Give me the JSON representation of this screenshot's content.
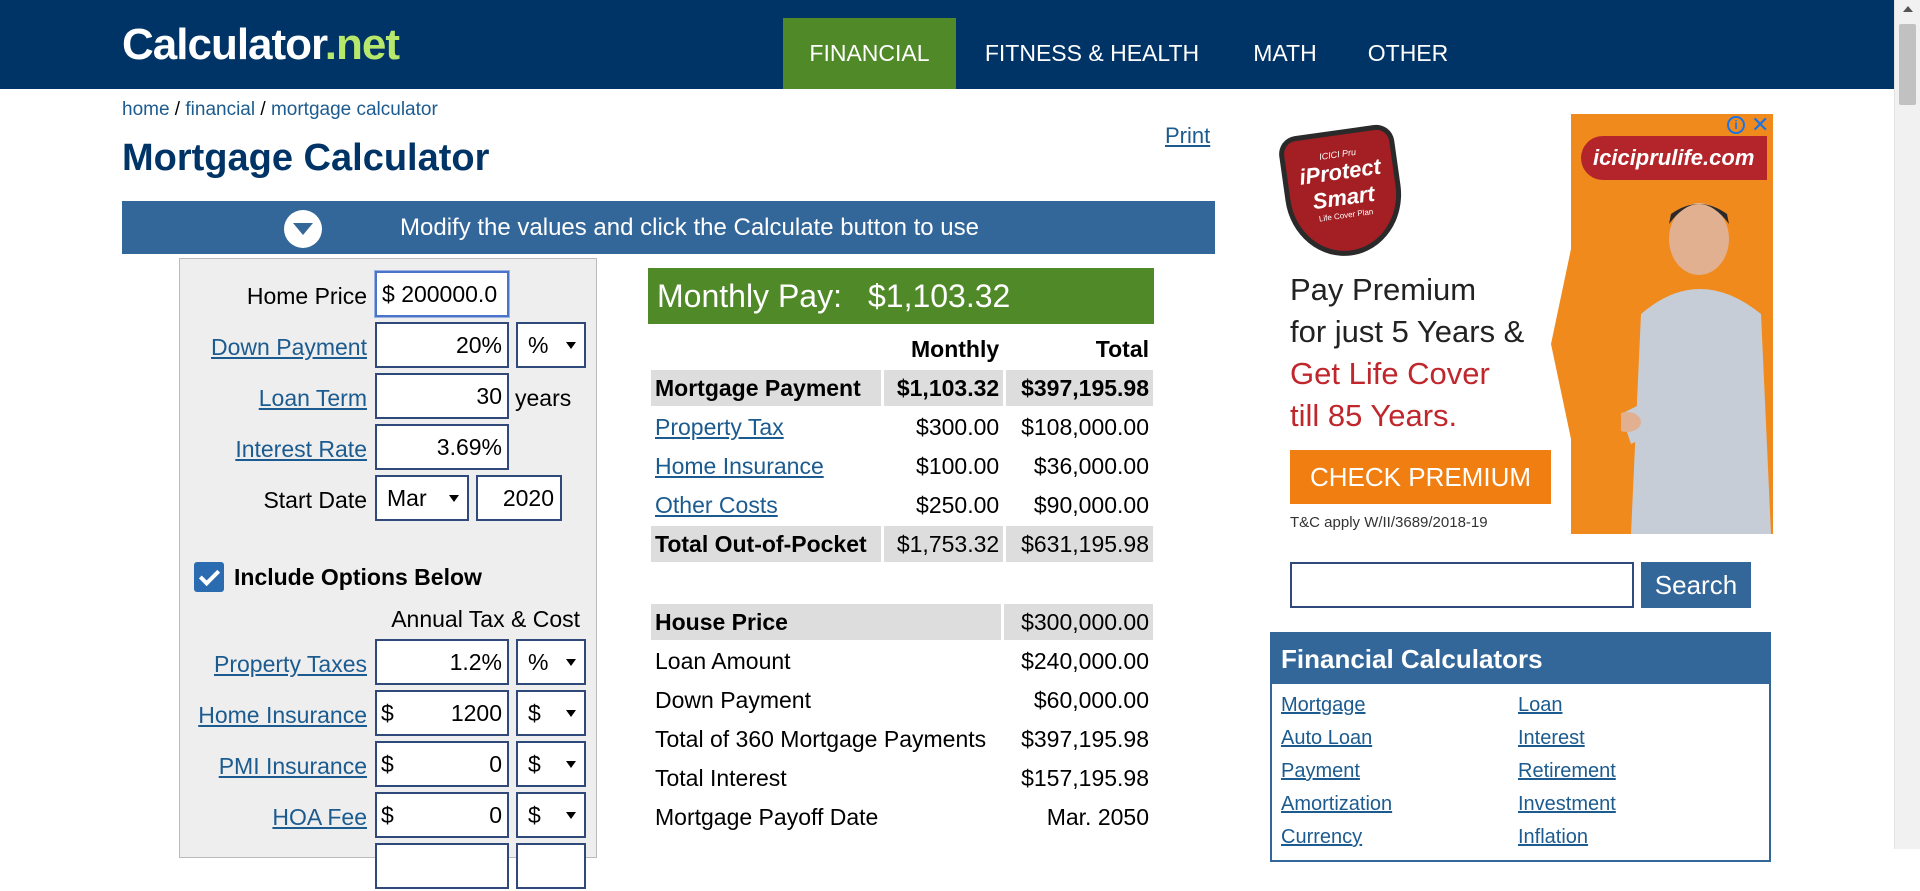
{
  "logo": {
    "main": "Calculator",
    "dot": ".",
    "net": "net"
  },
  "nav": [
    {
      "label": "FINANCIAL",
      "active": true
    },
    {
      "label": "FITNESS & HEALTH"
    },
    {
      "label": "MATH"
    },
    {
      "label": "OTHER"
    }
  ],
  "breadcrumb": {
    "home": "home",
    "sep1": " / ",
    "financial": "financial",
    "sep2": " / ",
    "current": "mortgage calculator"
  },
  "print_label": "Print",
  "page_title": "Mortgage Calculator",
  "modify_text": "Modify the values and click the Calculate button to use",
  "form": {
    "home_price": {
      "label": "Home Price",
      "prefix": "$",
      "value": "200000.0"
    },
    "down_payment": {
      "label": "Down Payment",
      "value": "20%",
      "unit": "%"
    },
    "loan_term": {
      "label": "Loan Term",
      "value": "30",
      "suffix": "years"
    },
    "interest_rate": {
      "label": "Interest Rate",
      "value": "3.69%"
    },
    "start_date": {
      "label": "Start Date",
      "month": "Mar",
      "year": "2020"
    },
    "include_options": "Include Options Below",
    "annual_label": "Annual Tax & Cost",
    "property_taxes": {
      "label": "Property Taxes",
      "value": "1.2%",
      "unit": "%"
    },
    "home_insurance": {
      "label": "Home Insurance",
      "prefix": "$",
      "value": "1200",
      "unit": "$"
    },
    "pmi_insurance": {
      "label": "PMI Insurance",
      "prefix": "$",
      "value": "0",
      "unit": "$"
    },
    "hoa_fee": {
      "label": "HOA Fee",
      "prefix": "$",
      "value": "0",
      "unit": "$"
    }
  },
  "results": {
    "monthly_label": "Monthly Pay:",
    "monthly_value": "$1,103.32",
    "col_monthly": "Monthly",
    "col_total": "Total",
    "rows": [
      {
        "label": "Mortgage Payment",
        "monthly": "$1,103.32",
        "total": "$397,195.98"
      },
      {
        "label": "Property Tax",
        "monthly": "$300.00",
        "total": "$108,000.00"
      },
      {
        "label": "Home Insurance",
        "monthly": "$100.00",
        "total": "$36,000.00"
      },
      {
        "label": "Other Costs",
        "monthly": "$250.00",
        "total": "$90,000.00"
      },
      {
        "label": "Total Out-of-Pocket",
        "monthly": "$1,753.32",
        "total": "$631,195.98"
      }
    ],
    "summary": [
      {
        "label": "House Price",
        "value": "$300,000.00"
      },
      {
        "label": "Loan Amount",
        "value": "$240,000.00"
      },
      {
        "label": "Down Payment",
        "value": "$60,000.00"
      },
      {
        "label": "Total of 360 Mortgage Payments",
        "value": "$397,195.98"
      },
      {
        "label": "Total Interest",
        "value": "$157,195.98"
      },
      {
        "label": "Mortgage Payoff Date",
        "value": "Mar. 2050"
      }
    ]
  },
  "ad": {
    "url": "iciciprulife.com",
    "badge1": "ICICI Pru",
    "badge2": "iProtect",
    "badge3": "Smart",
    "badge4": "Life Cover Plan",
    "line1": "Pay Premium",
    "line2": "for just 5 Years &",
    "line3": "Get Life Cover",
    "line4": "till 85 Years.",
    "cta": "CHECK PREMIUM",
    "fine": "T&C apply W/II/3689/2018-19"
  },
  "search": {
    "placeholder": "",
    "button": "Search"
  },
  "financial_calculators": {
    "title": "Financial Calculators",
    "left": [
      "Mortgage",
      "Auto Loan",
      "Payment",
      "Amortization",
      "Currency"
    ],
    "right": [
      "Loan",
      "Interest",
      "Retirement",
      "Investment",
      "Inflation"
    ]
  }
}
